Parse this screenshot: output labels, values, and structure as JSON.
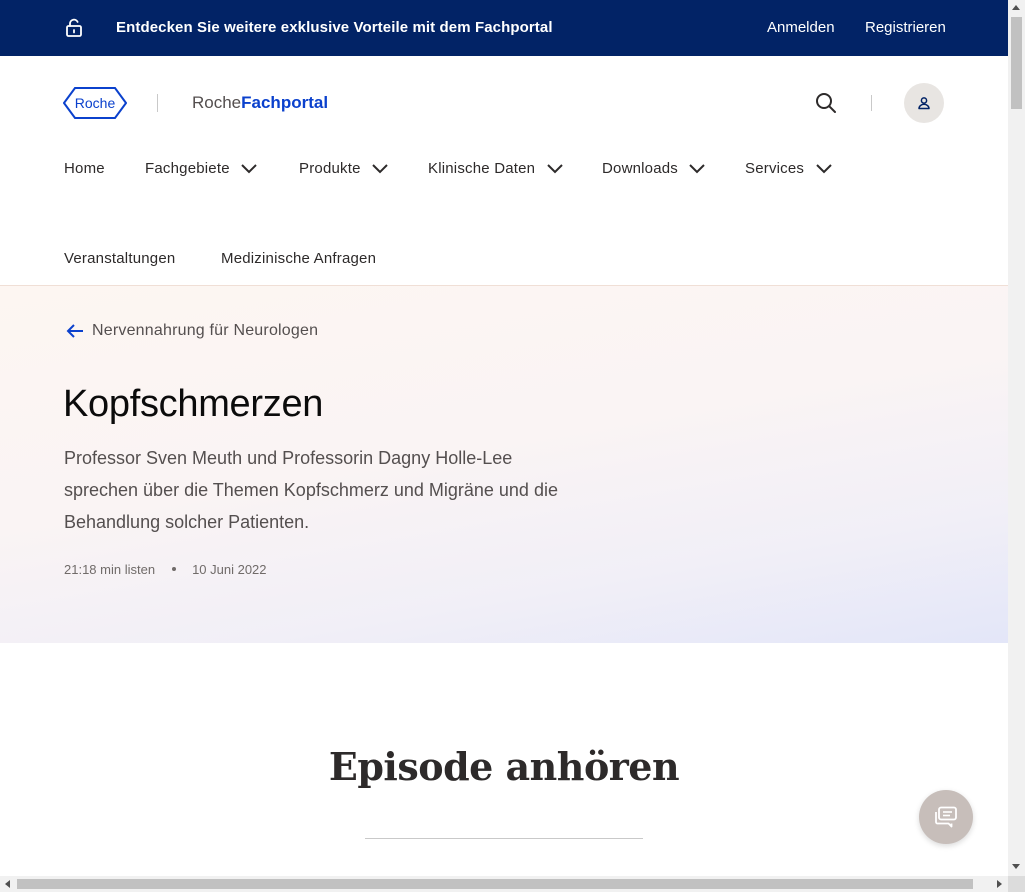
{
  "banner": {
    "promo": "Entdecken Sie weitere exklusive Vorteile mit dem Fachportal",
    "login": "Anmelden",
    "register": "Registrieren",
    "icon": "lock-icon"
  },
  "header": {
    "logo_text": "Roche",
    "brand_prefix": "Roche",
    "brand_suffix": "Fachportal",
    "search_icon": "search-icon",
    "user_icon": "user-icon"
  },
  "nav": {
    "items": [
      {
        "label": "Home",
        "dropdown": false
      },
      {
        "label": "Fachgebiete",
        "dropdown": true
      },
      {
        "label": "Produkte",
        "dropdown": true
      },
      {
        "label": "Klinische Daten",
        "dropdown": true
      },
      {
        "label": "Downloads",
        "dropdown": true
      },
      {
        "label": "Services",
        "dropdown": true
      },
      {
        "label": "Veranstaltungen",
        "dropdown": false
      },
      {
        "label": "Medizinische Anfragen",
        "dropdown": false
      }
    ]
  },
  "hero": {
    "back_label": "Nervennahrung für Neurologen",
    "title": "Kopfschmerzen",
    "description": "Professor Sven Meuth und Professorin Dagny Holle-Lee sprechen über die Themen Kopfschmerz und Migräne und die Behandlung solcher Patienten.",
    "duration": "21:18 min listen",
    "date": "10 Juni 2022"
  },
  "episode": {
    "heading": "Episode anhören"
  },
  "colors": {
    "banner_bg": "#022366",
    "brand_blue": "#0b41cd",
    "text_dark": "#0b0b0b",
    "text_muted": "#544f4f",
    "chat_button": "#c7beba"
  },
  "chat": {
    "icon": "chat-icon"
  }
}
